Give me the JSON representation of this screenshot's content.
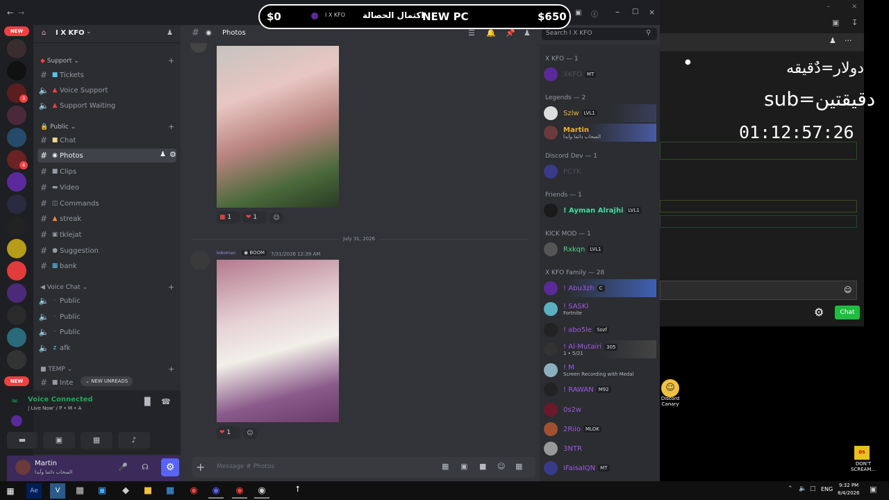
{
  "overlay": {
    "left_amount": "$0",
    "right_amount": "$650",
    "goal_label": "اكتمال الحصالة",
    "goal_item": "NEW PC",
    "server_tag": "I X KFO",
    "rate_line1": "دولار=دٌقيقه",
    "rate_line2": "sub=دقيقتين",
    "timer": "01:12:57:26"
  },
  "server": {
    "name": "I X KFO",
    "badge_new_top": "NEW",
    "badge_new_bottom": "NEW",
    "mention_count": "3",
    "mention_count2": "4"
  },
  "channels": {
    "support_cat": "Support",
    "tickets": "Tickets",
    "voice_support": "Voice Support",
    "support_waiting": "Support Waiting",
    "public_cat": "Public",
    "chat": "Chat",
    "photos": "Photos",
    "clips": "Clips",
    "video": "Video",
    "commands": "Commands",
    "streak": "streak",
    "tklejat": "tklejat",
    "suggestion": "Suggestion",
    "bank": "bank",
    "voice_cat": "Voice Chat",
    "public1": "Public",
    "public2": "Public",
    "public3": "Public",
    "afk": "afk",
    "temp_cat": "TEMP",
    "inte": "Inte",
    "new_unreads": "NEW UNREADS"
  },
  "voice": {
    "status": "Voice Connected",
    "channel": "| Live Now' / P • M • A"
  },
  "user": {
    "name": "Martin",
    "status": "السحاب دائما وأبدا"
  },
  "header": {
    "channel": "Photos",
    "search_placeholder": "Search I X KFO"
  },
  "messages": {
    "reaction1_count": "1",
    "reaction2_count": "1",
    "date_divider": "July 31, 2026",
    "author": "kokoman",
    "author_tag": "BOOM",
    "timestamp": "7/31/2026 12:39 AM",
    "reaction3_count": "1",
    "input_placeholder": "Message # Photos"
  },
  "members": {
    "g1": "X KFO — 1",
    "m1": "XKFO",
    "m1_badge": "MT",
    "g2": "Legends — 2",
    "m2": "Szlw",
    "m2_badge": "LVL1",
    "m3": "Martin",
    "m3_sub": "السحاب دائما وأبدا",
    "g3": "Discord Dev — 1",
    "m4": "PCYK",
    "g4": "Friends — 1",
    "m5": "! Ayman Alrajhi",
    "m5_badge": "LVL1",
    "g5": "KICK MOD — 1",
    "m6": "Rxkqn",
    "m6_badge": "LVL1",
    "g6": "X KFO Family — 28",
    "m7": "! Abu3zh",
    "m7_badge": "C",
    "m8": "! SASKI",
    "m8_sub": "Fortnite",
    "m9": "! abo5le",
    "m9_badge": "Sozf",
    "m10": "! Al-Mutairi",
    "m10_badge": "305",
    "m10_sub": "1 • 5/21",
    "m11": "! M",
    "m11_sub": "Screen Recording with Medal",
    "m12": "! RAWAN",
    "m12_badge": "M92",
    "m13": "0s2w",
    "m14": "2Riio",
    "m14_badge": "MLOK",
    "m15": "3NTR",
    "m16": "IFaisalQN",
    "m16_badge": "MT"
  },
  "right_panel": {
    "chat_button": "Chat",
    "desktop_icon": "Discord Canary",
    "desktop_icon2": "DON'T SCREAM..."
  },
  "taskbar": {
    "lang": "ENG",
    "time": "9:32 PM",
    "date": "8/4/2026"
  },
  "colors": {
    "accent": "#5865f2",
    "green": "#23a55a",
    "red": "#f23f43"
  }
}
